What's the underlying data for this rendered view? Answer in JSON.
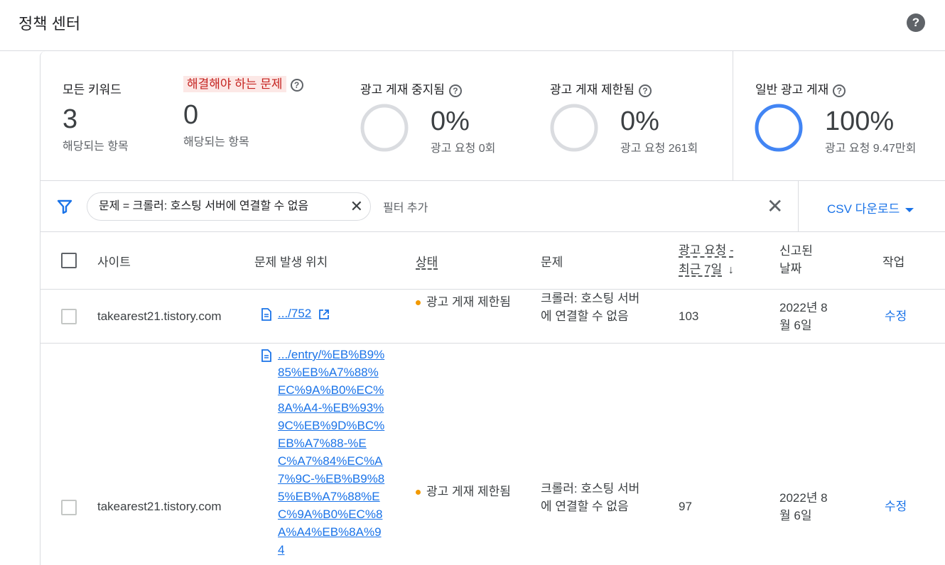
{
  "header": {
    "title": "정책 센터",
    "help_icon": "help-icon"
  },
  "summary": {
    "all_keywords": {
      "label": "모든 키워드",
      "value": "3",
      "sub": "해당되는 항목"
    },
    "issues": {
      "label": "해결해야 하는 문제",
      "value": "0",
      "sub": "해당되는 항목"
    },
    "serving_stopped": {
      "label": "광고 게재 중지됨",
      "percent": "0%",
      "sub": "광고 요청 0회",
      "fraction": 0
    },
    "serving_limited": {
      "label": "광고 게재 제한됨",
      "percent": "0%",
      "sub": "광고 요청 261회",
      "fraction": 0
    },
    "serving_normal": {
      "label": "일반 광고 게재",
      "percent": "100%",
      "sub": "광고 요청 9.47만회",
      "fraction": 1
    }
  },
  "filter": {
    "chip_text": "문제 = 크롤러: 호스팅 서버에 연결할 수 없음",
    "add_filter": "필터 추가",
    "csv_label": "CSV 다운로드"
  },
  "table": {
    "headers": {
      "site": "사이트",
      "location": "문제 발생 위치",
      "status": "상태",
      "issue": "문제",
      "requests_1": "광고 요청 -",
      "requests_2": "최근 7일",
      "reported_1": "신고된",
      "reported_2": "날짜",
      "action": "작업"
    },
    "rows": [
      {
        "site": "takearest21.tistory.com",
        "url": ".../752",
        "status": "광고 게재 제한됨",
        "issue": "크롤러: 호스팅 서버에 연결할 수 없음",
        "requests": "103",
        "date": "2022년 8월 6일",
        "action": "수정"
      },
      {
        "site": "takearest21.tistory.com",
        "url": ".../entry/%EB%B9%85%EB%A7%88%EC%9A%B0%EC%8A%A4-%EB%93%9C%EB%9D%BC%EB%A7%88-%EC%A7%84%EC%A7%9C-%EB%B9%85%EB%A7%88%EC%9A%B0%EC%8A%A4%EB%8A%94",
        "status": "광고 게재 제한됨",
        "issue": "크롤러: 호스팅 서버에 연결할 수 없음",
        "requests": "97",
        "date": "2022년 8월 6일",
        "action": "수정"
      }
    ]
  },
  "colors": {
    "accent": "#1a73e8",
    "alert_bg": "#fce8e6",
    "alert_text": "#c5221f",
    "warning_dot": "#f29900",
    "ring_track": "#dadce0"
  }
}
